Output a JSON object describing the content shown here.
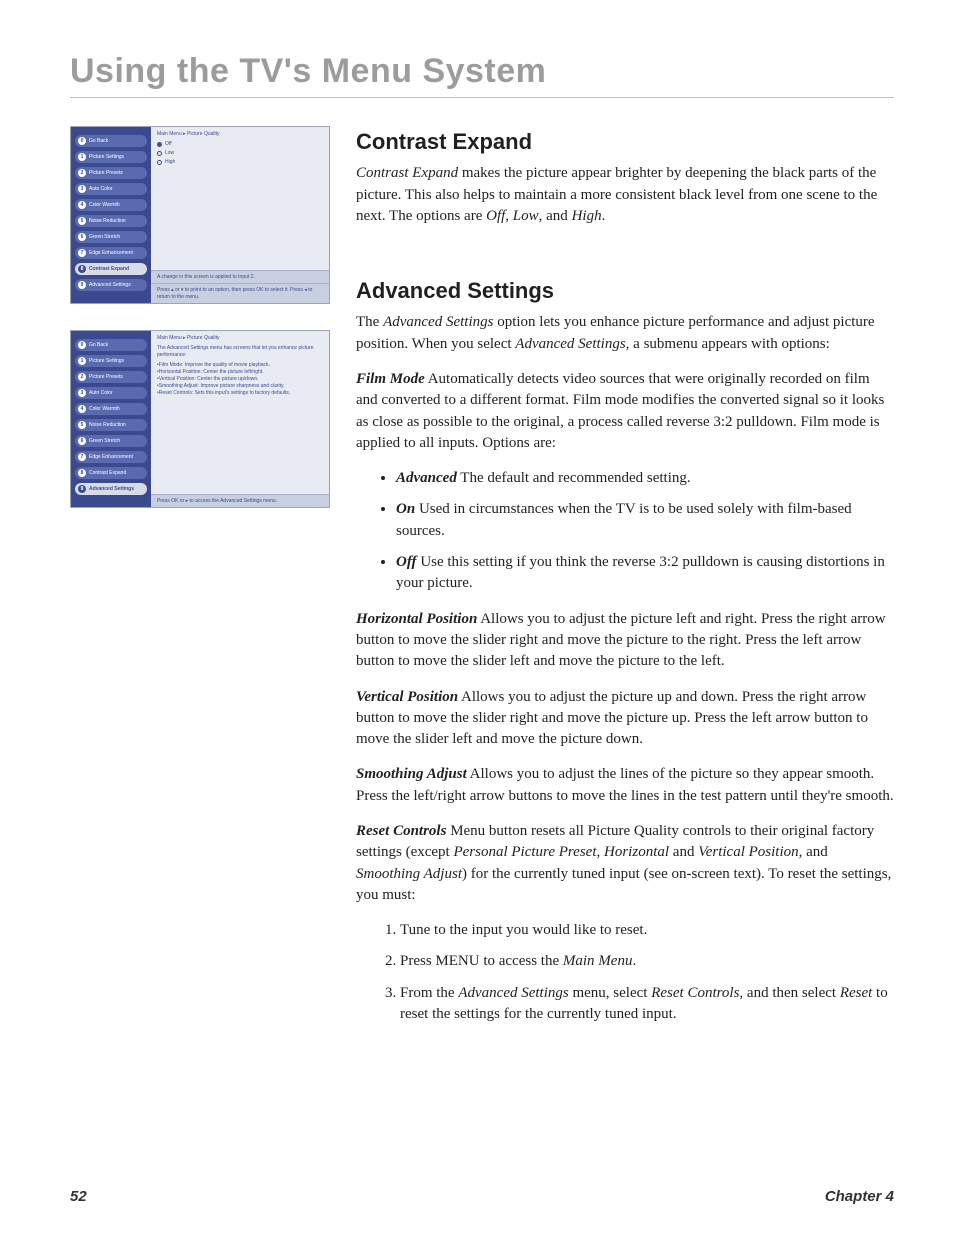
{
  "chapter_title": "Using the TV's Menu System",
  "breadcrumb": "Main Menu ▸ Picture Quality",
  "sidebar_items": [
    {
      "n": "0",
      "label": "Go Back"
    },
    {
      "n": "1",
      "label": "Picture Settings"
    },
    {
      "n": "2",
      "label": "Picture Presets"
    },
    {
      "n": "3",
      "label": "Auto Color"
    },
    {
      "n": "4",
      "label": "Color Warmth"
    },
    {
      "n": "5",
      "label": "Noise Reduction"
    },
    {
      "n": "6",
      "label": "Green Stretch"
    },
    {
      "n": "7",
      "label": "Edge Enhancement"
    },
    {
      "n": "8",
      "label": "Contrast Expand"
    },
    {
      "n": "9",
      "label": "Advanced Settings"
    }
  ],
  "shot1": {
    "selected_index": 8,
    "options": [
      "Off",
      "Low",
      "High"
    ],
    "msg1": "A change in this screen is applied to Input 2.",
    "msg2": "Press ▴ or ▾ to point to an option, then press OK to select it. Press ◂ to return to the menu."
  },
  "shot2": {
    "selected_index": 9,
    "intro": "The Advanced Settings menu has screens that let you enhance picture performance:",
    "lines": [
      "•Film Mode: Improve the quality of movie playback.",
      "•Horizontal Position: Center the picture left/right.",
      "•Vertical Position: Center the picture up/down.",
      "•Smoothing Adjust: Improve picture sharpness and clarity.",
      "•Reset Controls: Sets this input's settings to factory defaults."
    ],
    "msg": "Press OK or ▸ to access the Advanced Settings menu."
  },
  "contrast": {
    "h": "Contrast Expand",
    "p_pre": "Contrast Expand",
    "p_rest": " makes the picture appear brighter by deepening the black parts of the picture. This also helps to maintain a more consistent black level from one scene to the next. The options are ",
    "opt1": "Off",
    "opt2": "Low",
    "opt3": "High",
    "comma": ", ",
    "and": ", and ",
    "period": "."
  },
  "advanced": {
    "h": "Advanced Settings",
    "intro_pre": "The ",
    "intro_em1": "Advanced Settings",
    "intro_mid": " option lets you enhance picture performance and adjust picture position. When you select ",
    "intro_em2": "Advanced Settings",
    "intro_post": ", a submenu appears with options:",
    "film": {
      "label": "Film Mode",
      "text": "   Automatically detects video sources that were originally recorded on film and converted to a different format. Film mode modifies the converted signal so it looks as close as possible to the original, a process called reverse 3:2 pulldown. Film mode is applied to all inputs. Options are:"
    },
    "bullets": [
      {
        "label": "Advanced",
        "text": "   The default and recommended setting."
      },
      {
        "label": "On",
        "text": "   Used in circumstances when the TV is to be used solely with film-based sources."
      },
      {
        "label": "Off",
        "text": "   Use this setting if you think the reverse 3:2 pulldown is causing distortions in your picture."
      }
    ],
    "hpos": {
      "label": "Horizontal Position",
      "text": "   Allows you to adjust the picture left and right. Press the right arrow button to move the slider right and move the picture to the right. Press the left arrow button to move the slider left and move the picture to the left."
    },
    "vpos": {
      "label": "Vertical Position",
      "text": "   Allows you to adjust the picture up and down. Press the right arrow button to move the slider right and move the picture up. Press the left arrow button to move the slider left and move the picture down."
    },
    "smooth": {
      "label": "Smoothing Adjust",
      "text": "   Allows you to adjust the lines of the picture so they appear smooth. Press the left/right arrow buttons to move the lines in the test pattern until they're smooth."
    },
    "reset": {
      "label": "Reset Controls",
      "t1": "   Menu button resets all Picture Quality controls to their original factory settings (except ",
      "e1": "Personal Picture Preset",
      "c1": ", ",
      "e2": "Horizontal",
      "a1": " and ",
      "e3": "Vertical Position,",
      "a2": " and ",
      "e4": "Smoothing Adjust",
      "t2": ") for the currently tuned input (see on-screen text). To reset the settings, you must:"
    },
    "steps": {
      "s1": "Tune to the input you would like to reset.",
      "s2_pre": "Press MENU to access the ",
      "s2_em": "Main Menu",
      "s2_post": ".",
      "s3_pre": "From the ",
      "s3_em1": "Advanced Settings",
      "s3_mid": " menu, select ",
      "s3_em2": "Reset Controls,",
      "s3_mid2": " and then select ",
      "s3_em3": "Reset",
      "s3_post": " to reset the settings for the currently tuned input."
    }
  },
  "footer": {
    "page": "52",
    "chapter": "Chapter 4"
  }
}
